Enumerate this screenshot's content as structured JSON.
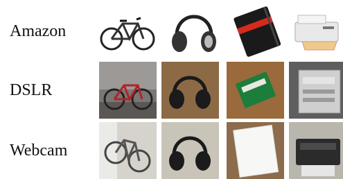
{
  "figure": {
    "rows": [
      {
        "label": "Amazon",
        "images": [
          {
            "object": "bicycle",
            "icon": "bicycle-icon"
          },
          {
            "object": "headphones",
            "icon": "headphones-icon"
          },
          {
            "object": "notebook",
            "icon": "notebook-icon"
          },
          {
            "object": "printer",
            "icon": "printer-icon"
          }
        ],
        "background": "#ffffff"
      },
      {
        "label": "DSLR",
        "images": [
          {
            "object": "bicycle",
            "icon": "bicycle-icon"
          },
          {
            "object": "headphones",
            "icon": "headphones-icon"
          },
          {
            "object": "notebook",
            "icon": "notebook-icon"
          },
          {
            "object": "printer",
            "icon": "printer-icon"
          }
        ],
        "background": "#8a6a4a"
      },
      {
        "label": "Webcam",
        "images": [
          {
            "object": "bicycle",
            "icon": "bicycle-icon"
          },
          {
            "object": "headphones",
            "icon": "headphones-icon"
          },
          {
            "object": "notebook",
            "icon": "notebook-icon"
          },
          {
            "object": "printer",
            "icon": "printer-icon"
          }
        ],
        "background": "#cfc8bd"
      }
    ]
  }
}
